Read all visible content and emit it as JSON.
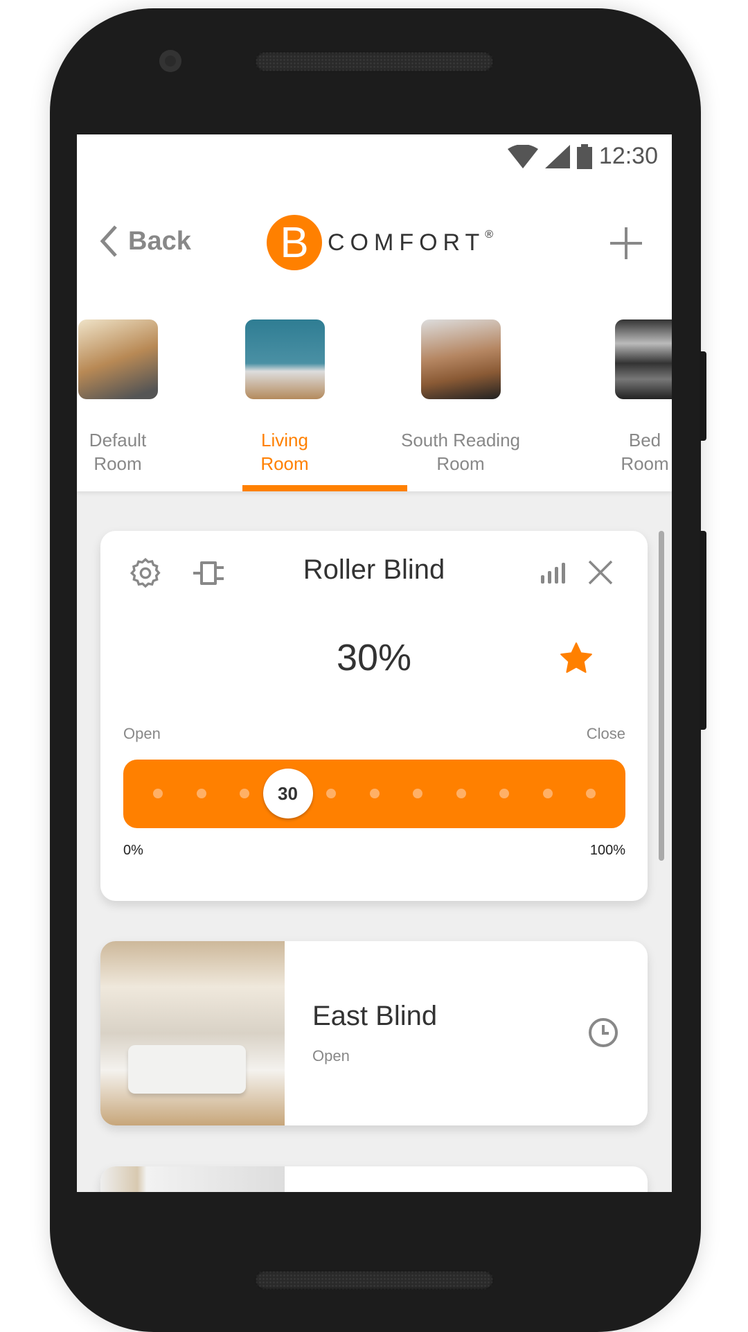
{
  "status_bar": {
    "time": "12:30",
    "icons": [
      "wifi-icon",
      "cell-signal-icon",
      "battery-icon"
    ]
  },
  "header": {
    "back_label": "Back",
    "logo_letter": "B",
    "logo_text": "COMFORT",
    "logo_mark": "®",
    "add_icon": "plus-icon"
  },
  "rooms": [
    {
      "line1": "Default",
      "line2": "Room",
      "active": false
    },
    {
      "line1": "Living",
      "line2": "Room",
      "active": true
    },
    {
      "line1": "South Reading",
      "line2": "Room",
      "active": false
    },
    {
      "line1": "Bed",
      "line2": "Room",
      "active": false
    }
  ],
  "device_card": {
    "title": "Roller Blind",
    "value": "30%",
    "favorite": true,
    "open_label": "Open",
    "close_label": "Close",
    "slider_value": "30",
    "slider_percent": 30,
    "min_label": "0%",
    "max_label": "100%",
    "icons": [
      "gear-icon",
      "plug-icon",
      "signal-bars-icon",
      "close-icon",
      "star-icon"
    ]
  },
  "devices": [
    {
      "name": "East Blind",
      "status": "Open",
      "icon": "clock-icon"
    }
  ],
  "colors": {
    "accent": "#ff8000",
    "text": "#333333",
    "muted": "#888888",
    "background": "#efefef"
  }
}
